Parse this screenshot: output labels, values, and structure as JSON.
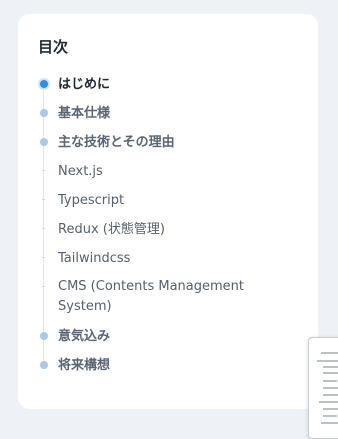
{
  "toc": {
    "title": "目次",
    "items": [
      {
        "label": "はじめに"
      },
      {
        "label": "基本仕様"
      },
      {
        "label": "主な技術とその理由"
      },
      {
        "label": "Next.js"
      },
      {
        "label": "Typescript"
      },
      {
        "label": "Redux (状態管理)"
      },
      {
        "label": "Tailwindcss"
      },
      {
        "label": "CMS (Contents Management System)"
      },
      {
        "label": "意気込み"
      },
      {
        "label": "将来構想"
      }
    ]
  },
  "colors": {
    "background": "#eef2f6",
    "card": "#ffffff",
    "active_bullet": "#2f8de4",
    "bullet": "#a7c9ea"
  }
}
